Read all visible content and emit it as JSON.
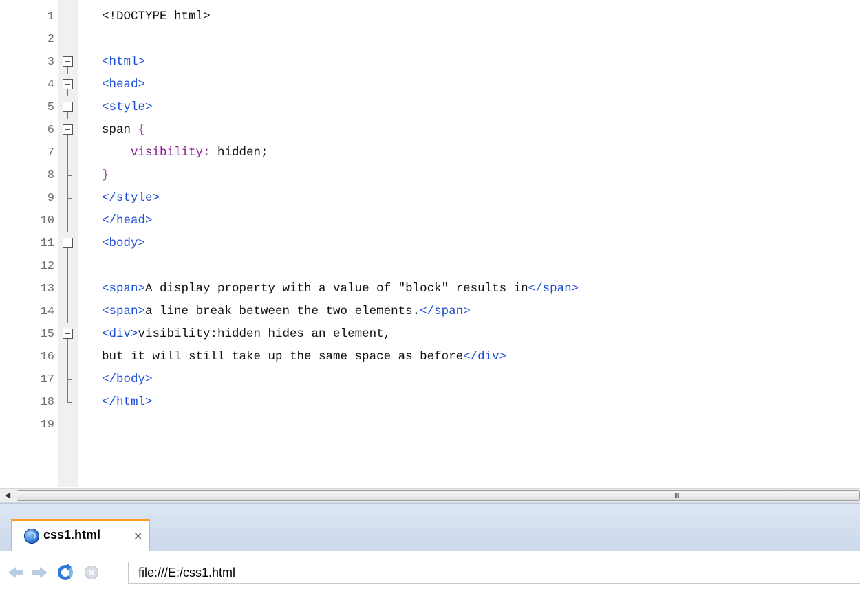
{
  "editor": {
    "lines": [
      {
        "n": "1",
        "fold": "none",
        "segs": [
          {
            "t": "<!DOCTYPE html>",
            "c": "plain"
          }
        ]
      },
      {
        "n": "2",
        "fold": "none",
        "segs": []
      },
      {
        "n": "3",
        "fold": "open",
        "segs": [
          {
            "t": "<html>",
            "c": "tag"
          }
        ]
      },
      {
        "n": "4",
        "fold": "open",
        "segs": [
          {
            "t": "<head>",
            "c": "tag"
          }
        ]
      },
      {
        "n": "5",
        "fold": "open",
        "segs": [
          {
            "t": "<style>",
            "c": "tag"
          }
        ]
      },
      {
        "n": "6",
        "fold": "open",
        "segs": [
          {
            "t": "span ",
            "c": "plain"
          },
          {
            "t": "{",
            "c": "brace"
          }
        ]
      },
      {
        "n": "7",
        "fold": "line",
        "segs": [
          {
            "t": "    ",
            "c": "plain"
          },
          {
            "t": "visibility:",
            "c": "prop"
          },
          {
            "t": " hidden;",
            "c": "plain"
          }
        ]
      },
      {
        "n": "8",
        "fold": "tick",
        "segs": [
          {
            "t": "}",
            "c": "brace"
          }
        ]
      },
      {
        "n": "9",
        "fold": "tick",
        "segs": [
          {
            "t": "</style>",
            "c": "tag"
          }
        ]
      },
      {
        "n": "10",
        "fold": "tick",
        "segs": [
          {
            "t": "</head>",
            "c": "tag"
          }
        ]
      },
      {
        "n": "11",
        "fold": "open",
        "segs": [
          {
            "t": "<body>",
            "c": "tag"
          }
        ]
      },
      {
        "n": "12",
        "fold": "line",
        "segs": []
      },
      {
        "n": "13",
        "fold": "line",
        "segs": [
          {
            "t": "<span>",
            "c": "tag"
          },
          {
            "t": "A display property with a value of \"block\" results in",
            "c": "plain"
          },
          {
            "t": "</span>",
            "c": "tag"
          }
        ]
      },
      {
        "n": "14",
        "fold": "line",
        "segs": [
          {
            "t": "<span>",
            "c": "tag"
          },
          {
            "t": "a line break between the two elements.",
            "c": "plain"
          },
          {
            "t": "</span>",
            "c": "tag"
          }
        ]
      },
      {
        "n": "15",
        "fold": "open",
        "segs": [
          {
            "t": "<div>",
            "c": "tag"
          },
          {
            "t": "visibility:hidden hides an element,",
            "c": "plain"
          }
        ]
      },
      {
        "n": "16",
        "fold": "tick",
        "segs": [
          {
            "t": "but it will still take up the same space as before",
            "c": "plain"
          },
          {
            "t": "</div>",
            "c": "tag"
          }
        ]
      },
      {
        "n": "17",
        "fold": "tick",
        "segs": [
          {
            "t": "</body>",
            "c": "tag"
          }
        ]
      },
      {
        "n": "18",
        "fold": "end",
        "segs": [
          {
            "t": "</html>",
            "c": "tag"
          }
        ]
      },
      {
        "n": "19",
        "fold": "none",
        "segs": []
      }
    ]
  },
  "scrollbar": {
    "left_arrow": "◀",
    "grip": "III"
  },
  "tabs": [
    {
      "label": "css1.html",
      "close": "×",
      "icon": "browser-globe-icon"
    }
  ],
  "navbar": {
    "icons": [
      "back-arrow-icon",
      "forward-arrow-icon",
      "reload-icon",
      "stop-icon"
    ],
    "stop_glyph": "×",
    "url": "file:///E:/css1.html"
  },
  "colors": {
    "tag": "#1a4dd6",
    "property": "#8b1a8b",
    "brace": "#a0509b",
    "active_tab_accent": "#ff9a1f",
    "tabbar_bg": "#c9d7ea"
  }
}
